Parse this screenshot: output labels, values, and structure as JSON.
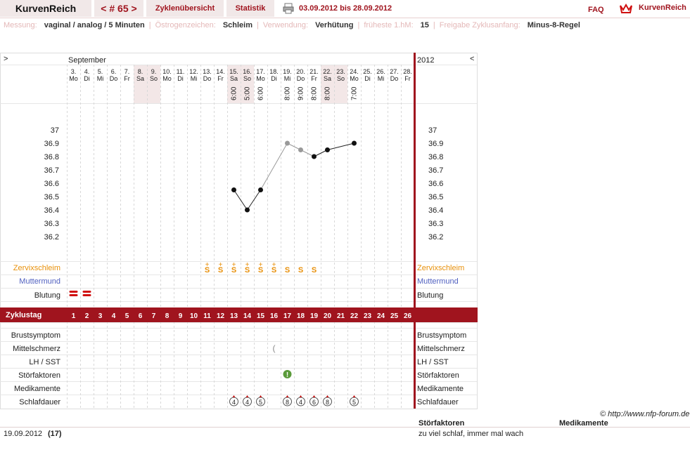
{
  "header": {
    "app_title": "KurvenReich",
    "cycle_nav": "< # 65 >",
    "tab_overview": "Zyklenübersicht",
    "tab_stats": "Statistik",
    "date_range": "03.09.2012 bis 28.09.2012",
    "faq": "FAQ",
    "brand": "KurvenReich",
    "accent_color": "#a0141e"
  },
  "info": {
    "messung_label": "Messung:",
    "messung_value": "vaginal / analog / 5 Minuten",
    "oestrogen_label": "Östrogenzeichen:",
    "oestrogen_value": "Schleim",
    "verwendung_label": "Verwendung:",
    "verwendung_value": "Verhütung",
    "frueheste_label": "früheste 1.hM:",
    "frueheste_value": "15",
    "freigabe_label": "Freigabe Zyklusanfang:",
    "freigabe_value": "Minus-8-Regel"
  },
  "nav": {
    "left_arrow": ">",
    "right_arrow": "<",
    "month": "September",
    "year": "2012"
  },
  "chart_data": {
    "type": "line",
    "title": "",
    "days": [
      {
        "date": "3.",
        "wd": "Mo",
        "time": "",
        "cycle": 1,
        "weekend": false
      },
      {
        "date": "4.",
        "wd": "Di",
        "time": "",
        "cycle": 2,
        "weekend": false
      },
      {
        "date": "5.",
        "wd": "Mi",
        "time": "",
        "cycle": 3,
        "weekend": false
      },
      {
        "date": "6.",
        "wd": "Do",
        "time": "",
        "cycle": 4,
        "weekend": false
      },
      {
        "date": "7.",
        "wd": "Fr",
        "time": "",
        "cycle": 5,
        "weekend": false
      },
      {
        "date": "8.",
        "wd": "Sa",
        "time": "",
        "cycle": 6,
        "weekend": true
      },
      {
        "date": "9.",
        "wd": "So",
        "time": "",
        "cycle": 7,
        "weekend": true
      },
      {
        "date": "10.",
        "wd": "Mo",
        "time": "",
        "cycle": 8,
        "weekend": false
      },
      {
        "date": "11.",
        "wd": "Di",
        "time": "",
        "cycle": 9,
        "weekend": false
      },
      {
        "date": "12.",
        "wd": "Mi",
        "time": "",
        "cycle": 10,
        "weekend": false
      },
      {
        "date": "13.",
        "wd": "Do",
        "time": "",
        "cycle": 11,
        "weekend": false
      },
      {
        "date": "14.",
        "wd": "Fr",
        "time": "",
        "cycle": 12,
        "weekend": false
      },
      {
        "date": "15.",
        "wd": "Sa",
        "time": "6:00",
        "cycle": 13,
        "weekend": true
      },
      {
        "date": "16.",
        "wd": "So",
        "time": "5:00",
        "cycle": 14,
        "weekend": true
      },
      {
        "date": "17.",
        "wd": "Mo",
        "time": "6:00",
        "cycle": 15,
        "weekend": false
      },
      {
        "date": "18.",
        "wd": "Di",
        "time": "",
        "cycle": 16,
        "weekend": false
      },
      {
        "date": "19.",
        "wd": "Mi",
        "time": "8:00",
        "cycle": 17,
        "weekend": false
      },
      {
        "date": "20.",
        "wd": "Do",
        "time": "9:00",
        "cycle": 18,
        "weekend": false
      },
      {
        "date": "21.",
        "wd": "Fr",
        "time": "8:00",
        "cycle": 19,
        "weekend": false
      },
      {
        "date": "22.",
        "wd": "Sa",
        "time": "8:00",
        "cycle": 20,
        "weekend": true
      },
      {
        "date": "23.",
        "wd": "So",
        "time": "",
        "cycle": 21,
        "weekend": true
      },
      {
        "date": "24.",
        "wd": "Mo",
        "time": "7:00",
        "cycle": 22,
        "weekend": false
      },
      {
        "date": "25.",
        "wd": "Di",
        "time": "",
        "cycle": 23,
        "weekend": false
      },
      {
        "date": "26.",
        "wd": "Mi",
        "time": "",
        "cycle": 24,
        "weekend": false
      },
      {
        "date": "27.",
        "wd": "Do",
        "time": "",
        "cycle": 25,
        "weekend": false
      },
      {
        "date": "28.",
        "wd": "Fr",
        "time": "",
        "cycle": 26,
        "weekend": false
      }
    ],
    "y_ticks": [
      "37",
      "36.9",
      "36.8",
      "36.7",
      "36.6",
      "36.5",
      "36.4",
      "36.3",
      "36.2"
    ],
    "ylim": [
      36.2,
      37.0
    ],
    "temperatures": [
      {
        "cycle_day": 13,
        "value": 36.55,
        "style": "black"
      },
      {
        "cycle_day": 14,
        "value": 36.4,
        "style": "black"
      },
      {
        "cycle_day": 15,
        "value": 36.55,
        "style": "black"
      },
      {
        "cycle_day": 17,
        "value": 36.9,
        "style": "grey"
      },
      {
        "cycle_day": 18,
        "value": 36.85,
        "style": "grey"
      },
      {
        "cycle_day": 19,
        "value": 36.8,
        "style": "black"
      },
      {
        "cycle_day": 20,
        "value": 36.85,
        "style": "black"
      },
      {
        "cycle_day": 22,
        "value": 36.9,
        "style": "black"
      }
    ],
    "mucus": [
      {
        "cycle_day": 11,
        "mark": "S+"
      },
      {
        "cycle_day": 12,
        "mark": "S+"
      },
      {
        "cycle_day": 13,
        "mark": "S+"
      },
      {
        "cycle_day": 14,
        "mark": "S+"
      },
      {
        "cycle_day": 15,
        "mark": "S+"
      },
      {
        "cycle_day": 16,
        "mark": "S+"
      },
      {
        "cycle_day": 17,
        "mark": "S"
      },
      {
        "cycle_day": 18,
        "mark": "S"
      },
      {
        "cycle_day": 19,
        "mark": "S"
      }
    ],
    "bleeding_days": [
      1,
      2
    ],
    "mittelschmerz_days": [
      16
    ],
    "stoerfaktor_days": [
      17
    ],
    "sleep": [
      {
        "cycle_day": 13,
        "hours": "4"
      },
      {
        "cycle_day": 14,
        "hours": "4"
      },
      {
        "cycle_day": 15,
        "hours": "5"
      },
      {
        "cycle_day": 17,
        "hours": "8"
      },
      {
        "cycle_day": 18,
        "hours": "4"
      },
      {
        "cycle_day": 19,
        "hours": "6"
      },
      {
        "cycle_day": 20,
        "hours": "8"
      },
      {
        "cycle_day": 22,
        "hours": "5"
      }
    ],
    "colors": {
      "mucus": "#e8900a",
      "muttermund": "#5060c0",
      "weekend": "#f3e7e7",
      "red": "#a0141e",
      "blood": "#d01010",
      "stoer": "#5a9a3a"
    }
  },
  "rows": {
    "zervixschleim": "Zervixschleim",
    "muttermund": "Muttermund",
    "blutung": "Blutung",
    "zyklustag": "Zyklustag",
    "brustsymptom": "Brustsymptom",
    "mittelschmerz": "Mittelschmerz",
    "lh_sst": "LH / SST",
    "stoerfaktoren": "Störfaktoren",
    "medikamente": "Medikamente",
    "schlafdauer": "Schlafdauer"
  },
  "footer": {
    "copyright": "© http://www.nfp-forum.de",
    "date": "19.09.2012",
    "cycle_day": "(17)",
    "stoer_header": "Störfaktoren",
    "medi_header": "Medikamente",
    "stoer_text": "zu viel schlaf, immer mal wach"
  }
}
